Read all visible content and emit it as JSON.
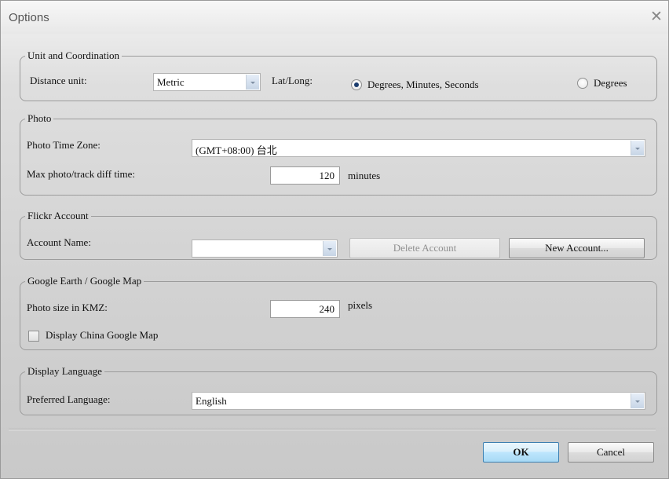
{
  "window": {
    "title": "Options",
    "close_symbol": "✕"
  },
  "unit": {
    "legend": "Unit and Coordination",
    "distance_label": "Distance unit:",
    "distance_value": "Metric",
    "latlong_label": "Lat/Long:",
    "opt_dms": "Degrees, Minutes, Seconds",
    "opt_deg": "Degrees",
    "selected": "Degrees, Minutes, Seconds"
  },
  "photo": {
    "legend": "Photo",
    "tz_label": "Photo Time Zone:",
    "tz_value": "(GMT+08:00) 台北",
    "diff_label": "Max photo/track diff time:",
    "diff_value": "120",
    "diff_unit": "minutes"
  },
  "flickr": {
    "legend": "Flickr Account",
    "account_label": "Account Name:",
    "account_value": "",
    "delete_label": "Delete Account",
    "new_label": "New Account..."
  },
  "google": {
    "legend": "Google Earth / Google Map",
    "size_label": "Photo size in KMZ:",
    "size_value": "240",
    "size_unit": "pixels",
    "china_label": "Display China Google Map",
    "china_checked": false
  },
  "language": {
    "legend": "Display Language",
    "pref_label": "Preferred Language:",
    "pref_value": "English"
  },
  "footer": {
    "ok_label": "OK",
    "cancel_label": "Cancel"
  },
  "icons": {
    "dropdown": "chevron-down-icon",
    "close": "close-icon"
  },
  "colors": {
    "default_button": "#bee6fd",
    "radio_dot": "#1a3c6e"
  }
}
